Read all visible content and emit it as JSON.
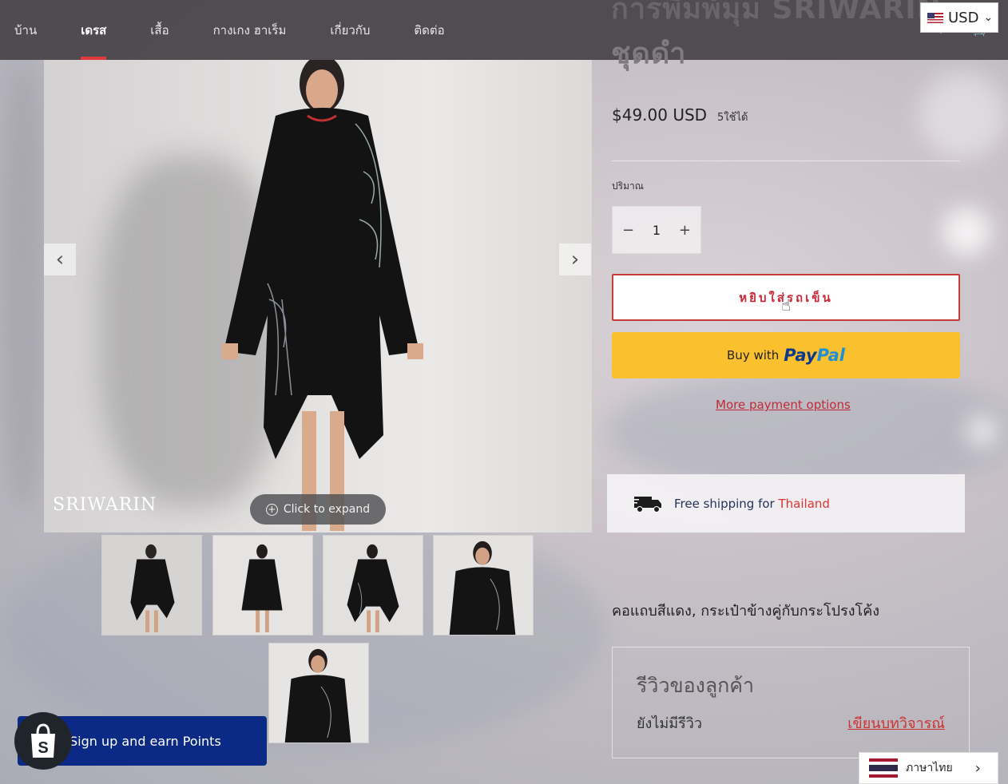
{
  "nav": {
    "items": [
      "บ้าน",
      "เดรส",
      "เสื้อ",
      "กางเกง ฮาเร็ม",
      "เกี่ยวกับ",
      "ติดต่อ"
    ],
    "active_index": 1
  },
  "currency": {
    "selected": "USD"
  },
  "product": {
    "title_line1": "การพิมพ์มุม SRIWARIN",
    "title_line2": "ชุดดำ",
    "price": "$49.00 USD",
    "stock": "5ใช้ได้",
    "quantity_label": "ปริมาณ",
    "quantity_value": "1",
    "description": "คอแถบสีแดง, กระเป๋าข้างคู่กับกระโปรงโค้ง"
  },
  "gallery": {
    "expand_label": "Click to expand",
    "logo_text": "SRIWARIN"
  },
  "buttons": {
    "add_to_cart": "หยิบใส่รถเข็น",
    "buy_with": "Buy with",
    "paypal_pay": "Pay",
    "paypal_pal": "Pal",
    "more_payment": "More payment options"
  },
  "shipping": {
    "text": "Free shipping for",
    "country": "Thailand"
  },
  "reviews": {
    "title": "รีวิวของลูกค้า",
    "empty": "ยังไม่มีรีวิว",
    "write": "เขียนบทวิจารณ์"
  },
  "language": {
    "label": "ภาษาไทย"
  },
  "signup": {
    "label": "Sign up and earn Points"
  },
  "colors": {
    "accent_red": "#c93a3a",
    "paypal_yellow": "#fbc02d",
    "signup_blue": "#0b2a85"
  }
}
